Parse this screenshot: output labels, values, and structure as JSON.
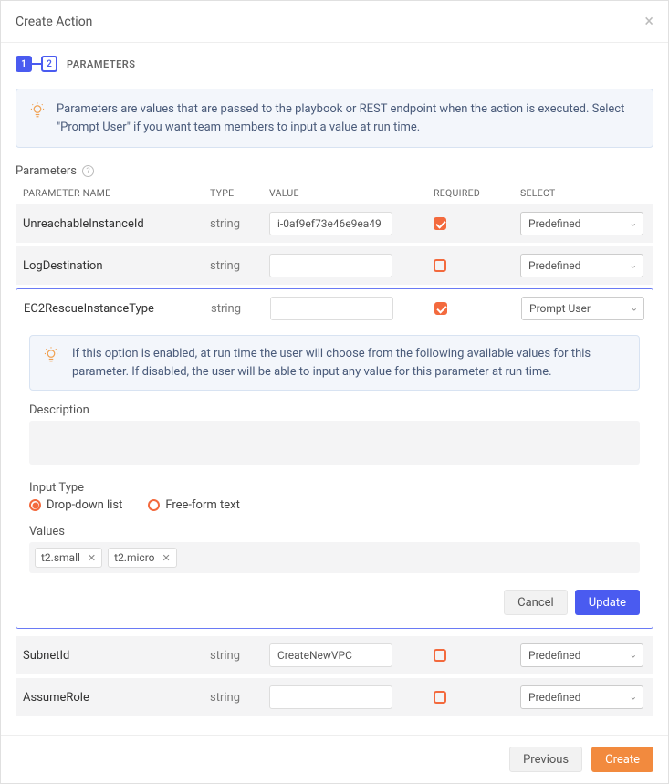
{
  "header": {
    "title": "Create Action"
  },
  "stepper": {
    "step1": "1",
    "step2": "2",
    "label": "PARAMETERS"
  },
  "info_main": "Parameters are values that are passed to the playbook or REST endpoint when the action is executed. Select \"Prompt User\" if you want team members to input a value at run time.",
  "section": {
    "title": "Parameters"
  },
  "columns": {
    "name": "PARAMETER NAME",
    "type": "TYPE",
    "value": "VALUE",
    "required": "REQUIRED",
    "select": "SELECT"
  },
  "rows": [
    {
      "name": "UnreachableInstanceId",
      "type": "string",
      "value": "i-0af9ef73e46e9ea49",
      "required": true,
      "select": "Predefined"
    },
    {
      "name": "LogDestination",
      "type": "string",
      "value": "",
      "required": false,
      "select": "Predefined"
    }
  ],
  "expanded": {
    "row": {
      "name": "EC2RescueInstanceType",
      "type": "string",
      "value": "",
      "required": true,
      "select": "Prompt User"
    },
    "info": "If this option is enabled, at run time the user will choose from the following available values for this parameter. If disabled, the user will be able to input any value for this parameter at run time.",
    "description_label": "Description",
    "description_value": "",
    "input_type_label": "Input Type",
    "input_type_options": {
      "dropdown": "Drop-down list",
      "freeform": "Free-form text"
    },
    "input_type_selected": "dropdown",
    "values_label": "Values",
    "values": [
      "t2.small",
      "t2.micro"
    ],
    "actions": {
      "cancel": "Cancel",
      "update": "Update"
    }
  },
  "rows_after": [
    {
      "name": "SubnetId",
      "type": "string",
      "value": "CreateNewVPC",
      "required": false,
      "select": "Predefined"
    },
    {
      "name": "AssumeRole",
      "type": "string",
      "value": "",
      "required": false,
      "select": "Predefined"
    }
  ],
  "footer": {
    "previous": "Previous",
    "create": "Create"
  }
}
